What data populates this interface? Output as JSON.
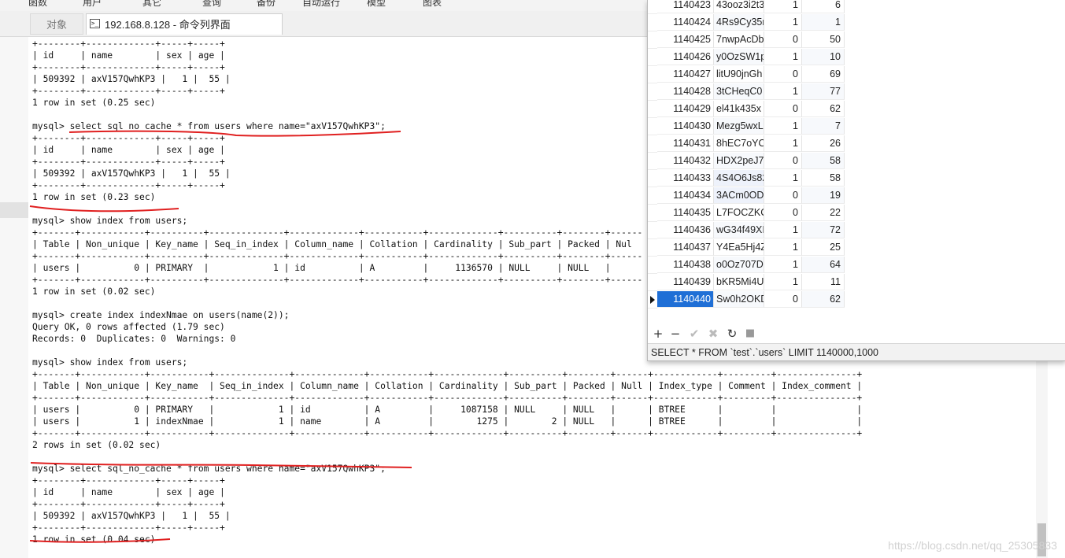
{
  "menu": [
    "函数",
    "用户",
    "其它",
    "查询",
    "备份",
    "自动运行",
    "模型",
    "图表"
  ],
  "tabs": {
    "objects": "对象",
    "console": "192.168.8.128 - 命令列界面",
    "console_icon": "terminal-icon"
  },
  "terminal": {
    "lines": [
      "+--------+-------------+-----+-----+",
      "| id     | name        | sex | age |",
      "+--------+-------------+-----+-----+",
      "| 509392 | axV157QwhKP3 |   1 |  55 |",
      "+--------+-------------+-----+-----+",
      "1 row in set (0.25 sec)",
      "",
      "mysql> select sql_no_cache * from users where name=\"axV157QwhKP3\";",
      "+--------+-------------+-----+-----+",
      "| id     | name        | sex | age |",
      "+--------+-------------+-----+-----+",
      "| 509392 | axV157QwhKP3 |   1 |  55 |",
      "+--------+-------------+-----+-----+",
      "1 row in set (0.23 sec)",
      "",
      "mysql> show index from users;",
      "+-------+------------+----------+--------------+-------------+-----------+-------------+----------+--------+------",
      "| Table | Non_unique | Key_name | Seq_in_index | Column_name | Collation | Cardinality | Sub_part | Packed | Nul",
      "+-------+------------+----------+--------------+-------------+-----------+-------------+----------+--------+------",
      "| users |          0 | PRIMARY  |            1 | id          | A         |     1136570 | NULL     | NULL   |",
      "+-------+------------+----------+--------------+-------------+-----------+-------------+----------+--------+------",
      "1 row in set (0.02 sec)",
      "",
      "mysql> create index indexNmae on users(name(2));",
      "Query OK, 0 rows affected (1.79 sec)",
      "Records: 0  Duplicates: 0  Warnings: 0",
      "",
      "mysql> show index from users;",
      "+-------+------------+-----------+--------------+-------------+-----------+-------------+----------+--------+------+------------+---------+---------------+",
      "| Table | Non_unique | Key_name  | Seq_in_index | Column_name | Collation | Cardinality | Sub_part | Packed | Null | Index_type | Comment | Index_comment |",
      "+-------+------------+-----------+--------------+-------------+-----------+-------------+----------+--------+------+------------+---------+---------------+",
      "| users |          0 | PRIMARY   |            1 | id          | A         |     1087158 | NULL     | NULL   |      | BTREE      |         |               |",
      "| users |          1 | indexNmae |            1 | name        | A         |        1275 |        2 | NULL   |      | BTREE      |         |               |",
      "+-------+------------+-----------+--------------+-------------+-----------+-------------+----------+--------+------+------------+---------+---------------+",
      "2 rows in set (0.02 sec)",
      "",
      "mysql> select sql_no_cache * from users where name=\"axV157QwhKP3\";",
      "+--------+-------------+-----+-----+",
      "| id     | name        | sex | age |",
      "+--------+-------------+-----+-----+",
      "| 509392 | axV157QwhKP3 |   1 |  55 |",
      "+--------+-------------+-----+-----+",
      "1 row in set (0.04 sec)",
      "",
      "mysql>"
    ]
  },
  "grid": {
    "rows": [
      {
        "id": "1140423",
        "name": "43ooz3i2t3",
        "sex": "1",
        "age": "6"
      },
      {
        "id": "1140424",
        "name": "4Rs9Cy35r",
        "sex": "1",
        "age": "1"
      },
      {
        "id": "1140425",
        "name": "7nwpAcDb",
        "sex": "0",
        "age": "50"
      },
      {
        "id": "1140426",
        "name": "y0OzSW1p",
        "sex": "1",
        "age": "10"
      },
      {
        "id": "1140427",
        "name": "litU90jnGh",
        "sex": "0",
        "age": "69"
      },
      {
        "id": "1140428",
        "name": "3tCHeqC0",
        "sex": "1",
        "age": "77"
      },
      {
        "id": "1140429",
        "name": "el41k435x",
        "sex": "0",
        "age": "62"
      },
      {
        "id": "1140430",
        "name": "Mezg5wxL",
        "sex": "1",
        "age": "7"
      },
      {
        "id": "1140431",
        "name": "8hEC7oYO",
        "sex": "1",
        "age": "26"
      },
      {
        "id": "1140432",
        "name": "HDX2peJ7",
        "sex": "0",
        "age": "58"
      },
      {
        "id": "1140433",
        "name": "4S4O6Js82",
        "sex": "1",
        "age": "58"
      },
      {
        "id": "1140434",
        "name": "3ACm0OD",
        "sex": "0",
        "age": "19"
      },
      {
        "id": "1140435",
        "name": "L7FOCZKC",
        "sex": "0",
        "age": "22"
      },
      {
        "id": "1140436",
        "name": "wG34f49XI",
        "sex": "1",
        "age": "72"
      },
      {
        "id": "1140437",
        "name": "Y4Ea5Hj4Z",
        "sex": "1",
        "age": "25"
      },
      {
        "id": "1140438",
        "name": "o0Oz707D",
        "sex": "1",
        "age": "64"
      },
      {
        "id": "1140439",
        "name": "bKR5Mi4U",
        "sex": "1",
        "age": "11"
      },
      {
        "id": "1140440",
        "name": "Sw0h2OKD",
        "sex": "0",
        "age": "62"
      }
    ],
    "selected_row": 17,
    "toolbar": {
      "add": "+",
      "delete": "−",
      "apply": "✔",
      "cancel": "✖",
      "refresh": "↻",
      "stop": "■"
    },
    "status": "SELECT * FROM `test`.`users` LIMIT 1140000,1000"
  },
  "watermark": "https://blog.csdn.net/qq_25305833",
  "colors": {
    "annotation": "#e02020",
    "selection": "#1f6fd6"
  }
}
